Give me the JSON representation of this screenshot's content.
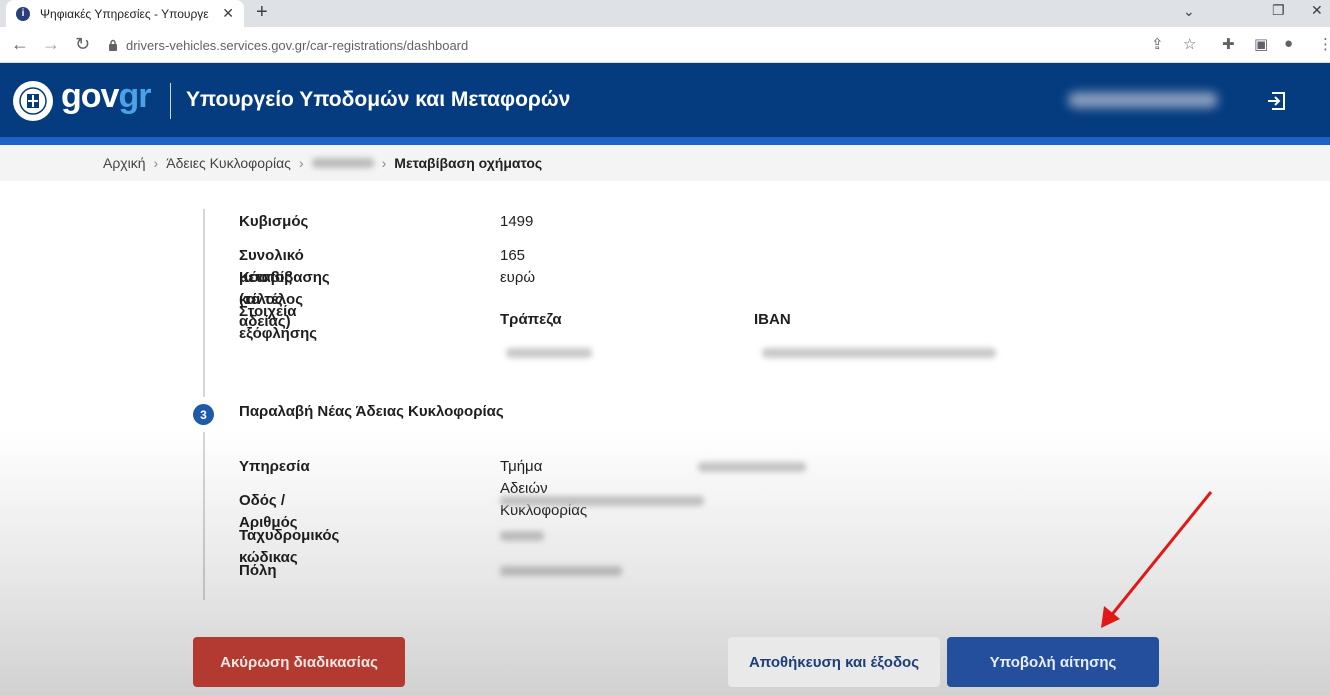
{
  "browser": {
    "tab_title": "Ψηφιακές Υπηρεσίες - Υπουργε",
    "url": "drivers-vehicles.services.gov.gr/car-registrations/dashboard"
  },
  "header": {
    "logo_gov": "gov",
    "logo_gr": "gr",
    "ministry": "Υπουργείο Υποδομών και Μεταφορών"
  },
  "breadcrumb": {
    "home": "Αρχική",
    "licenses": "Άδειες Κυκλοφορίας",
    "current": "Μεταβίβαση οχήματος"
  },
  "details": {
    "displacement_label": "Κυβισμός",
    "displacement_value": "1499",
    "cost_label_line1": "Συνολικό Κόστος (τέλος",
    "cost_label_line2": "μεταβίβασης και τέλος αδείας)",
    "cost_value": "165 ευρώ",
    "payment_label": "Στοιχεία εξόφλησης",
    "bank_header": "Τράπεζα",
    "iban_header": "IBAN"
  },
  "step3": {
    "number": "3",
    "title": "Παραλαβή Νέας Άδειας Κυκλοφορίας",
    "service_label": "Υπηρεσία",
    "service_value": "Τμήμα Αδειών Κυκλοφορίας",
    "street_label": "Οδός / Αριθμός",
    "postal_label": "Ταχυδρομικός κώδικας",
    "city_label": "Πόλη"
  },
  "buttons": {
    "cancel": "Ακύρωση διαδικασίας",
    "save": "Αποθήκευση και έξοδος",
    "submit": "Υποβολή αίτησης"
  },
  "colors": {
    "header_bg": "#053c7f",
    "accent_blue": "#1e62c8",
    "cancel_red": "#b23a30",
    "submit_blue": "#234f9c",
    "annotation_arrow": "#e01818"
  }
}
